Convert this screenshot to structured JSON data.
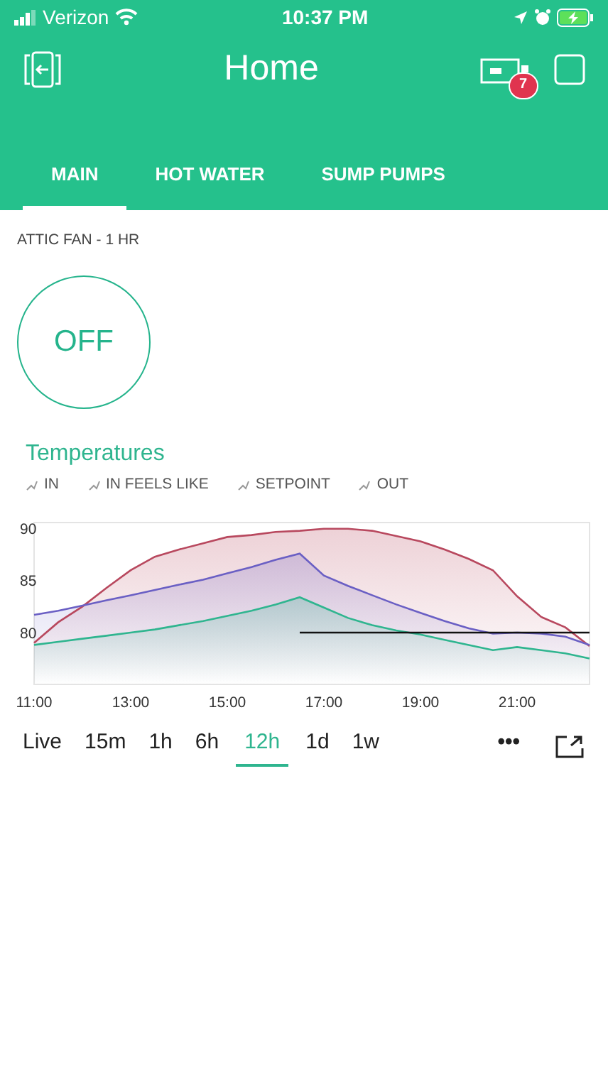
{
  "status_bar": {
    "carrier": "Verizon",
    "time": "10:37 PM"
  },
  "header": {
    "title": "Home",
    "badge": "7"
  },
  "tabs": [
    {
      "label": "MAIN",
      "selected": true
    },
    {
      "label": "HOT WATER",
      "selected": false
    },
    {
      "label": "SUMP PUMPS",
      "selected": false
    }
  ],
  "button_widget": {
    "label": "ATTIC FAN - 1 HR",
    "value": "OFF",
    "on": false
  },
  "chart_widget": {
    "title": "Temperatures",
    "chart_data": {
      "type": "area",
      "xlim": [
        11,
        22.5
      ],
      "ylim": [
        75,
        90.6
      ],
      "yticks": [
        80,
        85,
        90
      ],
      "xticks": [
        {
          "value": 11,
          "label": "11:00"
        },
        {
          "value": 13,
          "label": "13:00"
        },
        {
          "value": 15,
          "label": "15:00"
        },
        {
          "value": 17,
          "label": "17:00"
        },
        {
          "value": 19,
          "label": "19:00"
        },
        {
          "value": 21,
          "label": "21:00"
        }
      ],
      "x": [
        11,
        11.5,
        12,
        12.5,
        13,
        13.5,
        14,
        14.5,
        15,
        15.5,
        16,
        16.5,
        17,
        17.5,
        18,
        18.5,
        19,
        19.5,
        20,
        20.5,
        21,
        21.5,
        22,
        22.5
      ],
      "series": [
        {
          "name": "IN",
          "color": "#2fb58f",
          "values": [
            78.8,
            79.1,
            79.4,
            79.7,
            80.0,
            80.3,
            80.7,
            81.1,
            81.6,
            82.1,
            82.7,
            83.4,
            82.4,
            81.4,
            80.7,
            80.2,
            79.8,
            79.3,
            78.8,
            78.3,
            78.6,
            78.3,
            78.0,
            77.5
          ]
        },
        {
          "name": "IN FEELS LIKE",
          "color": "#6a5fc4",
          "values": [
            81.7,
            82.1,
            82.6,
            83.1,
            83.6,
            84.1,
            84.6,
            85.1,
            85.7,
            86.3,
            87.0,
            87.6,
            85.5,
            84.5,
            83.6,
            82.7,
            81.9,
            81.1,
            80.4,
            79.9,
            80.0,
            79.9,
            79.6,
            78.8
          ]
        },
        {
          "name": "SETPOINT",
          "type": "line",
          "color": "#111111",
          "values": [
            null,
            null,
            null,
            null,
            null,
            null,
            null,
            null,
            null,
            null,
            null,
            80,
            80,
            80,
            80,
            80,
            80,
            80,
            80,
            80,
            80,
            80,
            80,
            80
          ]
        },
        {
          "name": "OUT",
          "color": "#b8485e",
          "values": [
            79,
            81,
            82.5,
            84.3,
            86,
            87.3,
            88,
            88.6,
            89.2,
            89.4,
            89.7,
            89.8,
            90,
            90,
            89.8,
            89.3,
            88.8,
            88,
            87.1,
            86,
            83.5,
            81.5,
            80.5,
            78.7
          ]
        }
      ]
    },
    "ranges": [
      {
        "label": "Live",
        "selected": false
      },
      {
        "label": "15m",
        "selected": false
      },
      {
        "label": "1h",
        "selected": false
      },
      {
        "label": "6h",
        "selected": false
      },
      {
        "label": "12h",
        "selected": true
      },
      {
        "label": "1d",
        "selected": false
      },
      {
        "label": "1w",
        "selected": false
      }
    ],
    "more": "•••"
  }
}
